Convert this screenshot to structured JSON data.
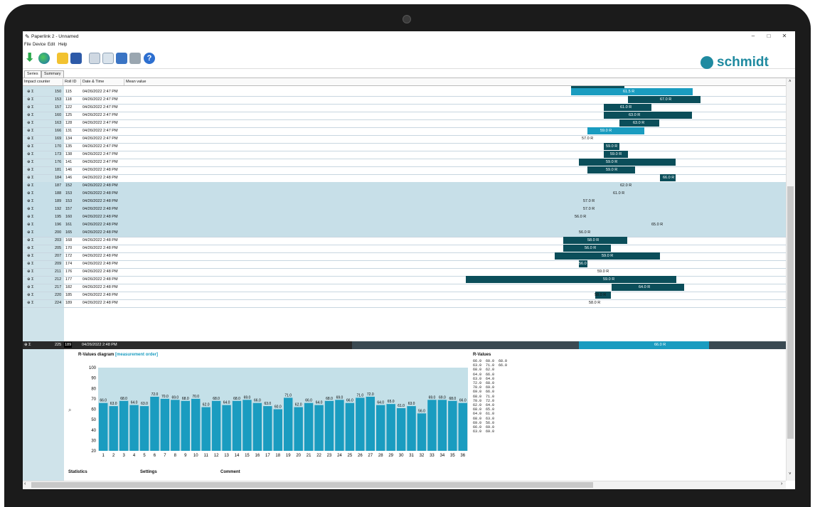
{
  "window": {
    "title": "Paperlink 2 - Unnamed",
    "controls": [
      "–",
      "□",
      "✕"
    ]
  },
  "menu": [
    "File",
    "Device",
    "Edit",
    "Help"
  ],
  "toolbar": {
    "icons": [
      "import-arrow-icon",
      "globe-icon",
      "open-folder-icon",
      "save-icon",
      "copy-icon",
      "find-icon",
      "book-icon",
      "print-icon",
      "help-icon"
    ]
  },
  "brand": {
    "name": "schmidt",
    "color": "#1f8aa0"
  },
  "tabs": [
    "Series",
    "Summary"
  ],
  "table": {
    "headers": [
      "Impact counter",
      "Roll ID",
      "Date & Time",
      "Mean value"
    ],
    "rows": [
      {
        "i": "150",
        "r": "115",
        "d": "04/26/2022 2:47 PM",
        "mean": "61.5"
      },
      {
        "i": "153",
        "r": "118",
        "d": "04/26/2022 2:47 PM",
        "mean": "67.0"
      },
      {
        "i": "157",
        "r": "122",
        "d": "04/26/2022 2:47 PM",
        "mean": "61.0"
      },
      {
        "i": "160",
        "r": "125",
        "d": "04/26/2022 2:47 PM",
        "mean": "63.0"
      },
      {
        "i": "163",
        "r": "128",
        "d": "04/26/2022 2:47 PM",
        "mean": "63.0"
      },
      {
        "i": "166",
        "r": "131",
        "d": "04/26/2022 2:47 PM",
        "mean": "59.0"
      },
      {
        "i": "169",
        "r": "134",
        "d": "04/26/2022 2:47 PM",
        "mean": "57.0"
      },
      {
        "i": "170",
        "r": "135",
        "d": "04/26/2022 2:47 PM",
        "mean": "59.0"
      },
      {
        "i": "173",
        "r": "138",
        "d": "04/26/2022 2:47 PM",
        "mean": "59.0"
      },
      {
        "i": "176",
        "r": "141",
        "d": "04/26/2022 2:47 PM",
        "mean": "59.0"
      },
      {
        "i": "181",
        "r": "146",
        "d": "04/26/2022 2:48 PM",
        "mean": "59.0"
      },
      {
        "i": "184",
        "r": "146",
        "d": "04/26/2022 2:48 PM",
        "mean": "66.0"
      },
      {
        "i": "187",
        "r": "152",
        "d": "04/26/2022 2:48 PM",
        "mean": "62.0"
      },
      {
        "i": "188",
        "r": "153",
        "d": "04/26/2022 2:48 PM",
        "mean": "61.0"
      },
      {
        "i": "189",
        "r": "153",
        "d": "04/26/2022 2:48 PM",
        "mean": "57.0"
      },
      {
        "i": "192",
        "r": "157",
        "d": "04/26/2022 2:48 PM",
        "mean": "57.0"
      },
      {
        "i": "195",
        "r": "160",
        "d": "04/26/2022 2:48 PM",
        "mean": "56.0"
      },
      {
        "i": "196",
        "r": "161",
        "d": "04/26/2022 2:48 PM",
        "mean": "65.0"
      },
      {
        "i": "200",
        "r": "165",
        "d": "04/26/2022 2:48 PM",
        "mean": "56.0"
      },
      {
        "i": "203",
        "r": "168",
        "d": "04/26/2022 2:48 PM",
        "mean": "58.0"
      },
      {
        "i": "205",
        "r": "170",
        "d": "04/26/2022 2:48 PM",
        "mean": "56.0"
      },
      {
        "i": "207",
        "r": "172",
        "d": "04/26/2022 2:48 PM",
        "mean": "59.0"
      },
      {
        "i": "209",
        "r": "174",
        "d": "04/26/2022 2:48 PM",
        "mean": "56.0"
      },
      {
        "i": "211",
        "r": "176",
        "d": "04/26/2022 2:48 PM",
        "mean": "59.0"
      },
      {
        "i": "212",
        "r": "177",
        "d": "04/26/2022 2:48 PM",
        "mean": "59.0"
      },
      {
        "i": "217",
        "r": "182",
        "d": "04/26/2022 2:48 PM",
        "mean": "64.0"
      },
      {
        "i": "220",
        "r": "185",
        "d": "04/26/2022 2:48 PM",
        "mean": "58.0"
      },
      {
        "i": "224",
        "r": "189",
        "d": "04/26/2022 2:48 PM",
        "mean": "58.0"
      },
      {
        "i": "225",
        "r": "189",
        "d": "04/26/2022 2:48 PM",
        "mean": "66.0"
      }
    ]
  },
  "chart_title": "R-Values diagram",
  "chart_subtitle": "[measurement order]",
  "chart_data": {
    "type": "bar",
    "categories": [
      "1",
      "2",
      "3",
      "4",
      "5",
      "6",
      "7",
      "8",
      "9",
      "10",
      "11",
      "12",
      "13",
      "14",
      "15",
      "16",
      "17",
      "18",
      "19",
      "20",
      "21",
      "22",
      "23",
      "24",
      "25",
      "26",
      "27",
      "28",
      "29",
      "30",
      "31",
      "32",
      "33",
      "34",
      "35",
      "36"
    ],
    "values": [
      66.0,
      63.0,
      68.0,
      64.0,
      63.0,
      72.0,
      70.0,
      69.0,
      68.0,
      70.0,
      62.0,
      68.0,
      64.0,
      68.0,
      69.0,
      66.0,
      63.0,
      60.0,
      71.0,
      62.0,
      66.0,
      64.0,
      68.0,
      69.0,
      66.0,
      71.0,
      72.0,
      64.0,
      65.0,
      61.0,
      63.0,
      56.0,
      69.0,
      69.0,
      68.0,
      66.0
    ],
    "ylim": [
      20,
      100
    ],
    "yticks": [
      20,
      30,
      40,
      50,
      60,
      70,
      80,
      90,
      100
    ],
    "bar_color": "#1a9cc0",
    "plot_bg": "#c4e0e8"
  },
  "rvalues": {
    "title": "R-Values",
    "lines": [
      "66.0  60.0  68.0",
      "63.0  71.0  66.0",
      "68.0  62.0",
      "64.0  66.0",
      "63.0  64.0",
      "72.0  68.0",
      "70.0  69.0",
      "69.0  66.0",
      "68.0  71.0",
      "70.0  72.0",
      "62.0  64.0",
      "68.0  65.0",
      "64.0  61.0",
      "68.0  63.0",
      "69.0  56.0",
      "66.0  69.0",
      "63.0  69.0"
    ]
  },
  "sections": [
    "Statistics",
    "Settings",
    "Comment"
  ]
}
